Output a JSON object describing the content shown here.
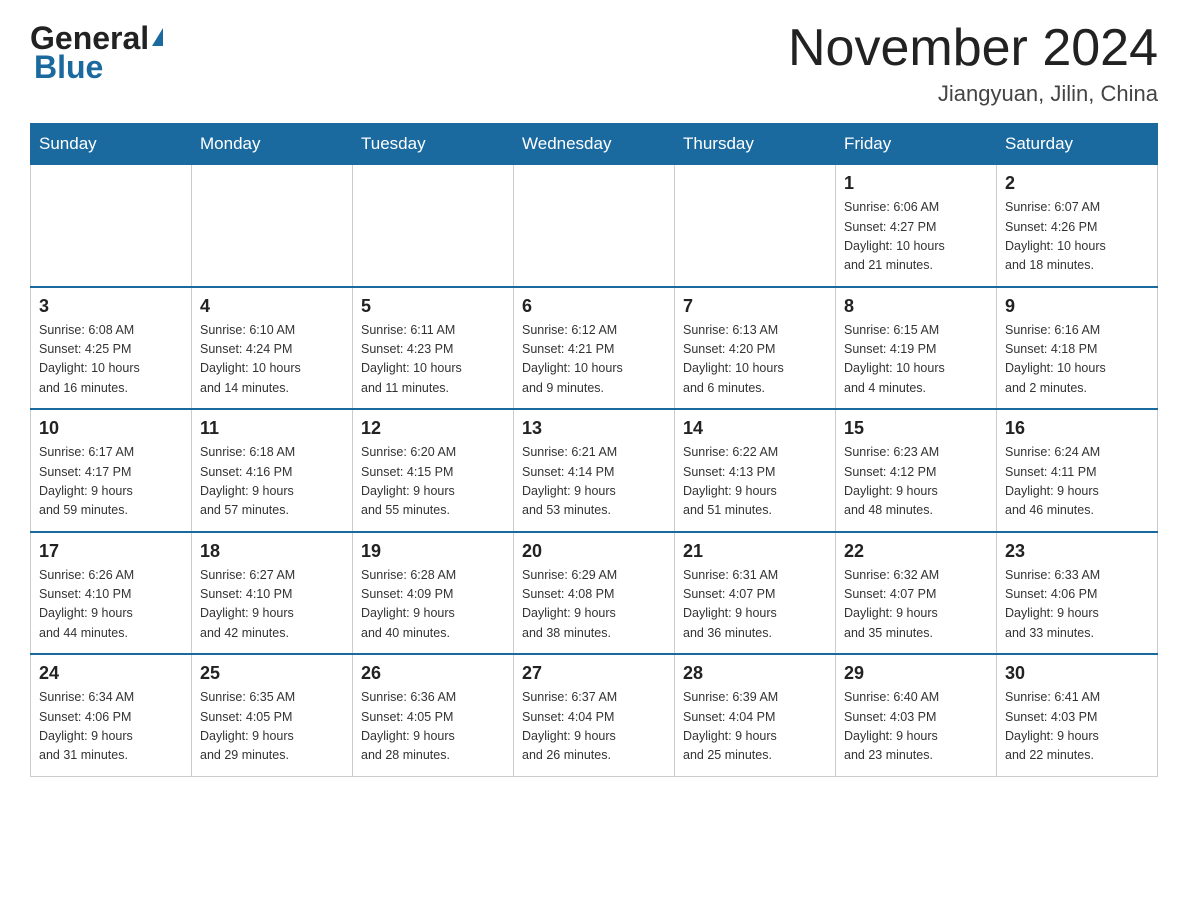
{
  "header": {
    "logo_general": "General",
    "logo_blue": "Blue",
    "month_title": "November 2024",
    "location": "Jiangyuan, Jilin, China"
  },
  "weekdays": [
    "Sunday",
    "Monday",
    "Tuesday",
    "Wednesday",
    "Thursday",
    "Friday",
    "Saturday"
  ],
  "weeks": [
    [
      {
        "day": "",
        "info": ""
      },
      {
        "day": "",
        "info": ""
      },
      {
        "day": "",
        "info": ""
      },
      {
        "day": "",
        "info": ""
      },
      {
        "day": "",
        "info": ""
      },
      {
        "day": "1",
        "info": "Sunrise: 6:06 AM\nSunset: 4:27 PM\nDaylight: 10 hours\nand 21 minutes."
      },
      {
        "day": "2",
        "info": "Sunrise: 6:07 AM\nSunset: 4:26 PM\nDaylight: 10 hours\nand 18 minutes."
      }
    ],
    [
      {
        "day": "3",
        "info": "Sunrise: 6:08 AM\nSunset: 4:25 PM\nDaylight: 10 hours\nand 16 minutes."
      },
      {
        "day": "4",
        "info": "Sunrise: 6:10 AM\nSunset: 4:24 PM\nDaylight: 10 hours\nand 14 minutes."
      },
      {
        "day": "5",
        "info": "Sunrise: 6:11 AM\nSunset: 4:23 PM\nDaylight: 10 hours\nand 11 minutes."
      },
      {
        "day": "6",
        "info": "Sunrise: 6:12 AM\nSunset: 4:21 PM\nDaylight: 10 hours\nand 9 minutes."
      },
      {
        "day": "7",
        "info": "Sunrise: 6:13 AM\nSunset: 4:20 PM\nDaylight: 10 hours\nand 6 minutes."
      },
      {
        "day": "8",
        "info": "Sunrise: 6:15 AM\nSunset: 4:19 PM\nDaylight: 10 hours\nand 4 minutes."
      },
      {
        "day": "9",
        "info": "Sunrise: 6:16 AM\nSunset: 4:18 PM\nDaylight: 10 hours\nand 2 minutes."
      }
    ],
    [
      {
        "day": "10",
        "info": "Sunrise: 6:17 AM\nSunset: 4:17 PM\nDaylight: 9 hours\nand 59 minutes."
      },
      {
        "day": "11",
        "info": "Sunrise: 6:18 AM\nSunset: 4:16 PM\nDaylight: 9 hours\nand 57 minutes."
      },
      {
        "day": "12",
        "info": "Sunrise: 6:20 AM\nSunset: 4:15 PM\nDaylight: 9 hours\nand 55 minutes."
      },
      {
        "day": "13",
        "info": "Sunrise: 6:21 AM\nSunset: 4:14 PM\nDaylight: 9 hours\nand 53 minutes."
      },
      {
        "day": "14",
        "info": "Sunrise: 6:22 AM\nSunset: 4:13 PM\nDaylight: 9 hours\nand 51 minutes."
      },
      {
        "day": "15",
        "info": "Sunrise: 6:23 AM\nSunset: 4:12 PM\nDaylight: 9 hours\nand 48 minutes."
      },
      {
        "day": "16",
        "info": "Sunrise: 6:24 AM\nSunset: 4:11 PM\nDaylight: 9 hours\nand 46 minutes."
      }
    ],
    [
      {
        "day": "17",
        "info": "Sunrise: 6:26 AM\nSunset: 4:10 PM\nDaylight: 9 hours\nand 44 minutes."
      },
      {
        "day": "18",
        "info": "Sunrise: 6:27 AM\nSunset: 4:10 PM\nDaylight: 9 hours\nand 42 minutes."
      },
      {
        "day": "19",
        "info": "Sunrise: 6:28 AM\nSunset: 4:09 PM\nDaylight: 9 hours\nand 40 minutes."
      },
      {
        "day": "20",
        "info": "Sunrise: 6:29 AM\nSunset: 4:08 PM\nDaylight: 9 hours\nand 38 minutes."
      },
      {
        "day": "21",
        "info": "Sunrise: 6:31 AM\nSunset: 4:07 PM\nDaylight: 9 hours\nand 36 minutes."
      },
      {
        "day": "22",
        "info": "Sunrise: 6:32 AM\nSunset: 4:07 PM\nDaylight: 9 hours\nand 35 minutes."
      },
      {
        "day": "23",
        "info": "Sunrise: 6:33 AM\nSunset: 4:06 PM\nDaylight: 9 hours\nand 33 minutes."
      }
    ],
    [
      {
        "day": "24",
        "info": "Sunrise: 6:34 AM\nSunset: 4:06 PM\nDaylight: 9 hours\nand 31 minutes."
      },
      {
        "day": "25",
        "info": "Sunrise: 6:35 AM\nSunset: 4:05 PM\nDaylight: 9 hours\nand 29 minutes."
      },
      {
        "day": "26",
        "info": "Sunrise: 6:36 AM\nSunset: 4:05 PM\nDaylight: 9 hours\nand 28 minutes."
      },
      {
        "day": "27",
        "info": "Sunrise: 6:37 AM\nSunset: 4:04 PM\nDaylight: 9 hours\nand 26 minutes."
      },
      {
        "day": "28",
        "info": "Sunrise: 6:39 AM\nSunset: 4:04 PM\nDaylight: 9 hours\nand 25 minutes."
      },
      {
        "day": "29",
        "info": "Sunrise: 6:40 AM\nSunset: 4:03 PM\nDaylight: 9 hours\nand 23 minutes."
      },
      {
        "day": "30",
        "info": "Sunrise: 6:41 AM\nSunset: 4:03 PM\nDaylight: 9 hours\nand 22 minutes."
      }
    ]
  ]
}
